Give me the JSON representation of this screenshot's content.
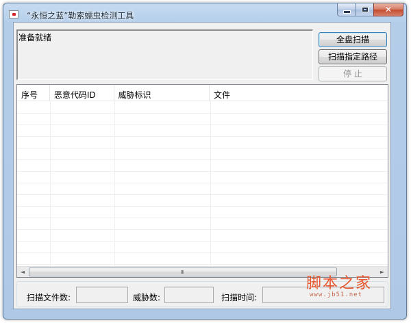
{
  "window": {
    "title": "“永恒之蓝”勒索蠕虫检测工具",
    "caption_close": "✕"
  },
  "log": {
    "text": "准备就绪"
  },
  "buttons": {
    "full_scan": "全盘扫描",
    "scan_path": "扫描指定路径",
    "stop": "停  止"
  },
  "table": {
    "columns": [
      "序号",
      "恶意代码ID",
      "威胁标识",
      "文件"
    ],
    "rows": []
  },
  "scrollbar": {
    "left_arrow": "◄",
    "right_arrow": "►",
    "grip": "III"
  },
  "status": {
    "files_scanned_label": "扫描文件数:",
    "files_scanned_value": "",
    "threats_label": "威胁数:",
    "threats_value": "",
    "scan_time_label": "扫描时间:",
    "scan_time_value": ""
  },
  "watermark": {
    "text": "脚本之家",
    "url": "www.jb51.net"
  },
  "colors": {
    "window_frame": "#b3cde9",
    "client_bg": "#f0f0f0",
    "close_button": "#c04a2e",
    "watermark": "#e8572e"
  },
  "icons": {
    "app": "app-window-icon",
    "minimize": "minimize-icon",
    "maximize": "maximize-icon",
    "close": "close-icon"
  }
}
